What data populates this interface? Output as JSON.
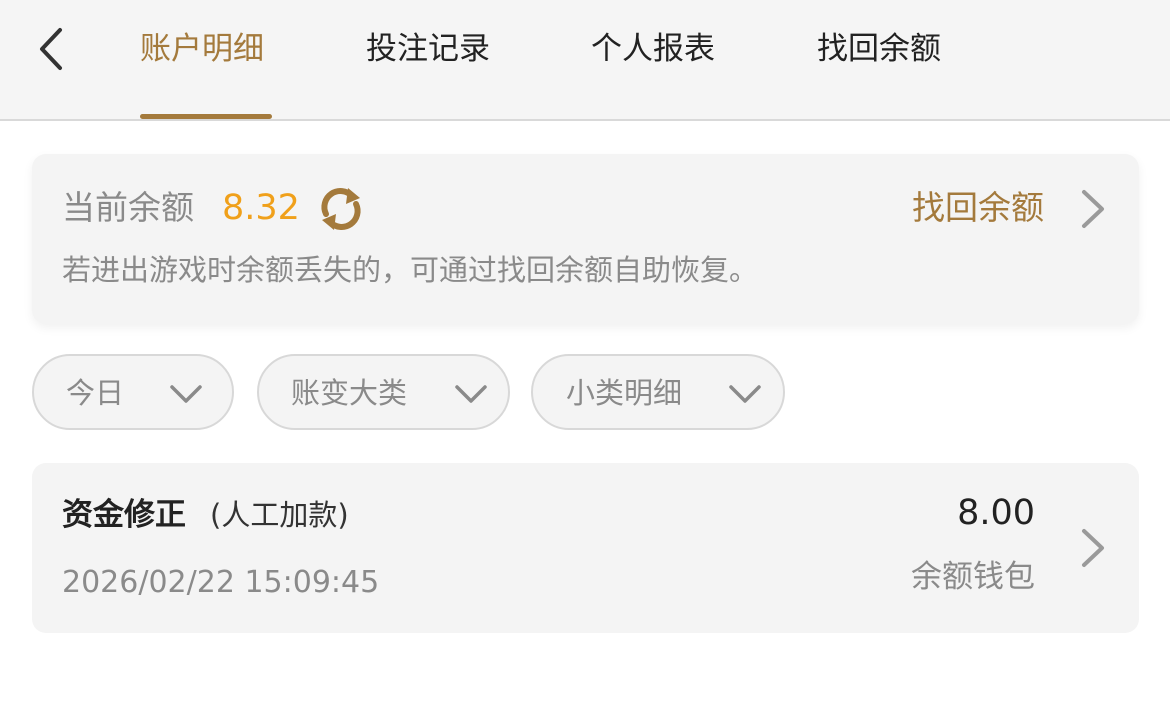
{
  "header": {
    "tabs": [
      {
        "label": "账户明细",
        "active": true
      },
      {
        "label": "投注记录",
        "active": false
      },
      {
        "label": "个人报表",
        "active": false
      },
      {
        "label": "找回余额",
        "active": false
      }
    ],
    "back_icon": "chevron-left-icon"
  },
  "balance_card": {
    "label": "当前余额",
    "value": "8.32",
    "refresh_icon": "refresh-icon",
    "recover_label": "找回余额",
    "hint": "若进出游戏时余额丢失的，可通过找回余额自助恢复。"
  },
  "filters": [
    {
      "label": "今日"
    },
    {
      "label": "账变大类"
    },
    {
      "label": "小类明细"
    }
  ],
  "records": [
    {
      "title": "资金修正",
      "subtitle": "(人工加款)",
      "time": "2026/02/22 15:09:45",
      "amount": "8.00",
      "wallet": "余额钱包"
    }
  ],
  "colors": {
    "accent": "#a47a3c",
    "balance_value": "#f0a01a",
    "muted_text": "#8a8a8a",
    "card_bg": "#f4f4f4"
  }
}
